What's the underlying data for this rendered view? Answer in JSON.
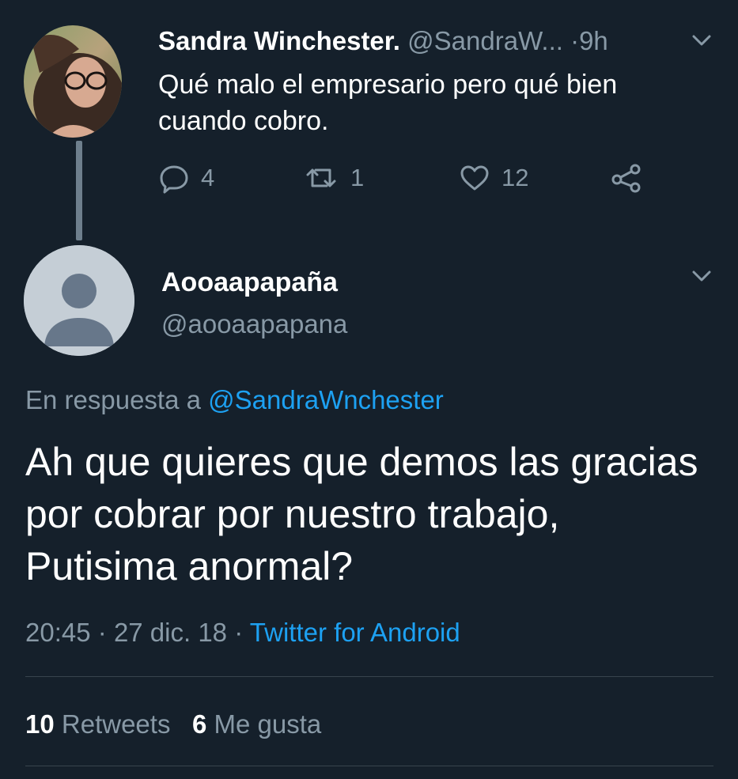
{
  "parent_tweet": {
    "display_name": "Sandra Winchester.",
    "handle": "@SandraW...",
    "separator": "·",
    "time": "9h",
    "text": "Qué malo el empresario pero qué bien cuando cobro.",
    "reply_count": "4",
    "retweet_count": "1",
    "like_count": "12",
    "icons": {
      "reply": "reply-bubble-icon",
      "retweet": "retweet-icon",
      "like": "heart-icon",
      "share": "share-icon",
      "menu": "chevron-down-icon"
    }
  },
  "reply_tweet": {
    "display_name": "Aooaapapaña",
    "handle": "@aooaapapana",
    "replying_prefix": "En respuesta a",
    "replying_to": "@SandraWnchester",
    "text": "Ah que quieres que demos las gracias por cobrar por nuestro trabajo, Putisima anormal?",
    "time": "20:45",
    "date": "27 dic. 18",
    "separator": "·",
    "source": "Twitter for Android",
    "retweets_count": "10",
    "retweets_label": "Retweets",
    "likes_count": "6",
    "likes_label": "Me gusta"
  },
  "colors": {
    "background": "#15202b",
    "secondary_text": "#8899a6",
    "link": "#1da1f2",
    "divider": "#38444d"
  }
}
